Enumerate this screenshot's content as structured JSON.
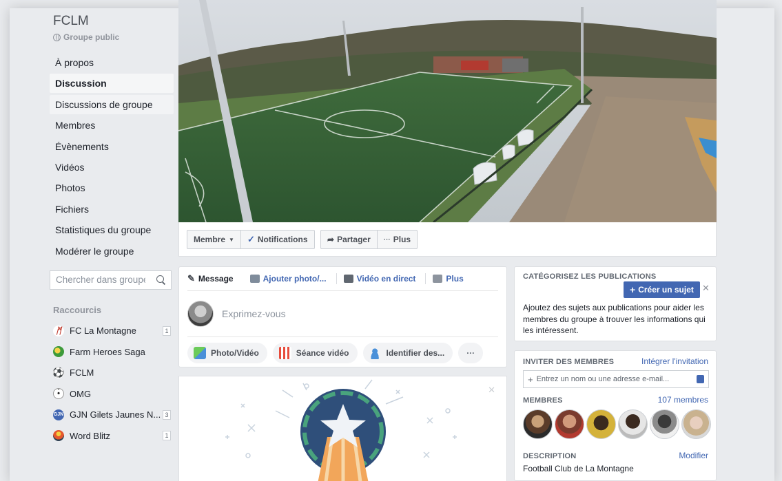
{
  "group": {
    "name": "FCLM",
    "type": "Groupe public"
  },
  "nav": [
    {
      "label": "À propos"
    },
    {
      "label": "Discussion"
    },
    {
      "label": "Discussions de groupe"
    },
    {
      "label": "Membres"
    },
    {
      "label": "Évènements"
    },
    {
      "label": "Vidéos"
    },
    {
      "label": "Photos"
    },
    {
      "label": "Fichiers"
    },
    {
      "label": "Statistiques du groupe"
    },
    {
      "label": "Modérer le groupe"
    }
  ],
  "search": {
    "placeholder": "Chercher dans groupe"
  },
  "shortcuts": {
    "title": "Raccourcis",
    "items": [
      {
        "label": "FC La Montagne",
        "badge": "1",
        "icon": "fclm-logo-icon",
        "color": "#c0392b"
      },
      {
        "label": "Farm Heroes Saga",
        "badge": "",
        "icon": "farm-heroes-icon",
        "color": "#3d9a3a"
      },
      {
        "label": "FCLM",
        "badge": "",
        "icon": "soccer-ball-icon",
        "color": "#222222"
      },
      {
        "label": "OMG",
        "badge": "",
        "icon": "omg-icon",
        "color": "#f1f1f1"
      },
      {
        "label": "GJN Gilets Jaunes N...",
        "badge": "3",
        "icon": "gjn-icon",
        "color": "#4267b2"
      },
      {
        "label": "Word Blitz",
        "badge": "1",
        "icon": "word-blitz-icon",
        "color": "#e4572e"
      }
    ]
  },
  "actions": {
    "membre": "Membre",
    "notifications": "Notifications",
    "partager": "Partager",
    "plus": "Plus"
  },
  "composer": {
    "tabs": {
      "message": "Message",
      "photo": "Ajouter photo/...",
      "live": "Vidéo en direct",
      "plus": "Plus"
    },
    "placeholder": "Exprimez-vous",
    "chips": {
      "photo": "Photo/Vidéo",
      "seance": "Séance vidéo",
      "tag": "Identifier des...",
      "more": "···"
    }
  },
  "categorize": {
    "title": "CATÉGORISEZ LES PUBLICATIONS",
    "button": "Créer un sujet",
    "text": "Ajoutez des sujets aux publications pour aider les membres du groupe à trouver les informations qui les intéressent."
  },
  "invite": {
    "title": "INVITER DES MEMBRES",
    "link": "Intégrer l'invitation",
    "placeholder": "Entrez un nom ou une adresse e-mail...",
    "members_title": "MEMBRES",
    "members_count": "107 membres",
    "description_title": "DESCRIPTION",
    "description_edit": "Modifier",
    "description": "Football Club de La Montagne"
  }
}
